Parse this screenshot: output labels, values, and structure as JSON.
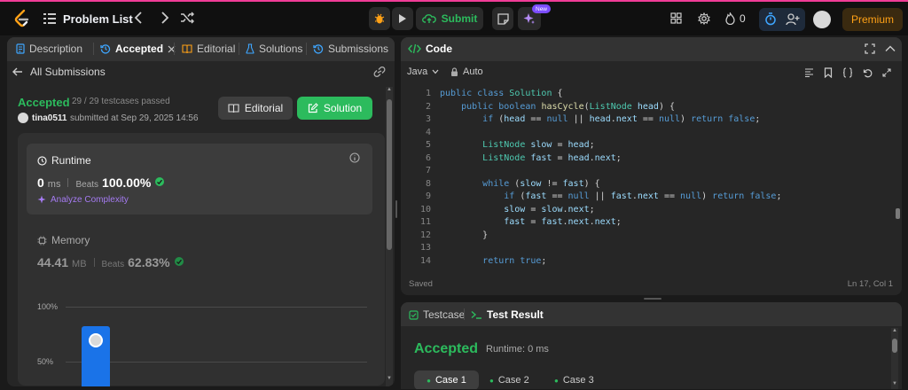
{
  "topbar": {
    "title": "Problem List",
    "submit_label": "Submit",
    "new_badge": "New",
    "points": "0",
    "premium_label": "Premium"
  },
  "left": {
    "tabs": [
      {
        "label": "Description"
      },
      {
        "label": "Accepted"
      },
      {
        "label": "Editorial"
      },
      {
        "label": "Solutions"
      },
      {
        "label": "Submissions"
      }
    ],
    "back_label": "All Submissions",
    "status": "Accepted",
    "testcases": "29 / 29 testcases passed",
    "username": "tina0511",
    "submitted_text": "submitted at Sep 29, 2025 14:56",
    "editorial_button": "Editorial",
    "solution_button": "Solution",
    "runtime": {
      "title": "Runtime",
      "value": "0",
      "unit": "ms",
      "beats_label": "Beats",
      "beats_value": "100.00%",
      "analyze": "Analyze Complexity"
    },
    "memory": {
      "title": "Memory",
      "value": "44.41",
      "unit": "MB",
      "beats_label": "Beats",
      "beats_value": "62.83%"
    },
    "chart": {
      "ticks": [
        "100%",
        "50%"
      ]
    }
  },
  "code": {
    "header": "Code",
    "language": "Java",
    "mode": "Auto",
    "status": "Saved",
    "cursor": "Ln 17, Col 1",
    "lines": [
      {
        "n": "1",
        "t": "public class Solution {"
      },
      {
        "n": "2",
        "t": "    public boolean hasCycle(ListNode head) {"
      },
      {
        "n": "3",
        "t": "        if (head == null || head.next == null) return false;"
      },
      {
        "n": "4",
        "t": ""
      },
      {
        "n": "5",
        "t": "        ListNode slow = head;"
      },
      {
        "n": "6",
        "t": "        ListNode fast = head.next;"
      },
      {
        "n": "7",
        "t": ""
      },
      {
        "n": "8",
        "t": "        while (slow != fast) {"
      },
      {
        "n": "9",
        "t": "            if (fast == null || fast.next == null) return false;"
      },
      {
        "n": "10",
        "t": "            slow = slow.next;"
      },
      {
        "n": "11",
        "t": "            fast = fast.next.next;"
      },
      {
        "n": "12",
        "t": "        }"
      },
      {
        "n": "13",
        "t": ""
      },
      {
        "n": "14",
        "t": "        return true;"
      }
    ]
  },
  "test": {
    "tab_testcase": "Testcase",
    "tab_result": "Test Result",
    "status": "Accepted",
    "runtime": "Runtime: 0 ms",
    "cases": [
      "Case 1",
      "Case 2",
      "Case 3"
    ]
  },
  "colors": {
    "accent_green": "#2cbb5d",
    "accent_orange": "#ffa116",
    "bar_blue": "#1a73e8",
    "premium": "#ffa116"
  }
}
